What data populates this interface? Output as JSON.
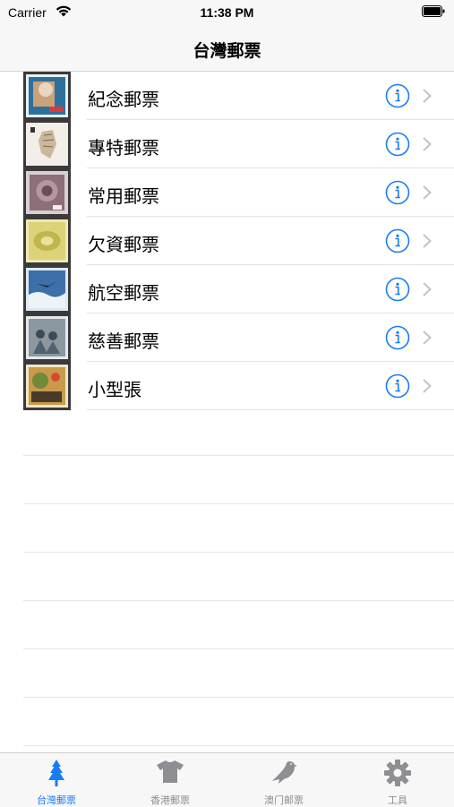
{
  "status_bar": {
    "carrier": "Carrier",
    "time": "11:38 PM"
  },
  "nav": {
    "title": "台灣郵票"
  },
  "rows": [
    {
      "label": "紀念郵票",
      "icon": "info-icon"
    },
    {
      "label": "專特郵票",
      "icon": "info-icon"
    },
    {
      "label": "常用郵票",
      "icon": "info-icon"
    },
    {
      "label": "欠資郵票",
      "icon": "info-icon"
    },
    {
      "label": "航空郵票",
      "icon": "info-icon"
    },
    {
      "label": "慈善郵票",
      "icon": "info-icon"
    },
    {
      "label": "小型張",
      "icon": "info-icon"
    }
  ],
  "tabs": [
    {
      "label": "台灣郵票",
      "icon": "tree-icon",
      "active": true
    },
    {
      "label": "香港郵票",
      "icon": "tshirt-icon",
      "active": false
    },
    {
      "label": "澳门邮票",
      "icon": "bird-icon",
      "active": false
    },
    {
      "label": "工具",
      "icon": "gear-icon",
      "active": false
    }
  ],
  "colors": {
    "accent": "#1a7cf5",
    "inactive_tab": "#8e8e93",
    "separator": "#e3e3e3"
  }
}
